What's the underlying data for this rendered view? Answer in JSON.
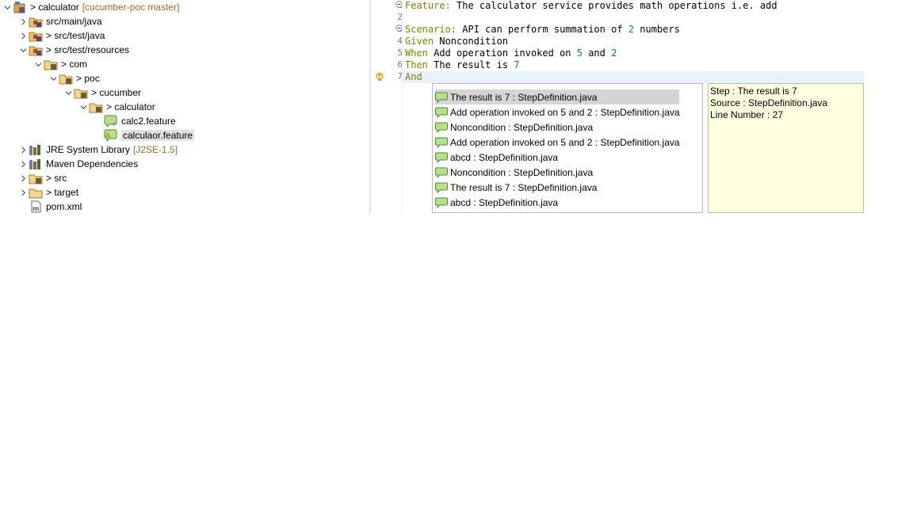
{
  "explorer": {
    "items": [
      {
        "label": "> calculator",
        "suffix": "[cucumber-poc master]",
        "icon": "project-icon"
      },
      {
        "label": "src/main/java",
        "icon": "source-folder-icon"
      },
      {
        "label": "> src/test/java",
        "icon": "source-folder-icon"
      },
      {
        "label": "> src/test/resources",
        "icon": "source-folder-icon"
      },
      {
        "label": "> com",
        "icon": "package-folder-icon"
      },
      {
        "label": "> poc",
        "icon": "package-folder-icon"
      },
      {
        "label": "> cucumber",
        "icon": "package-folder-icon"
      },
      {
        "label": "> calculator",
        "icon": "package-folder-icon"
      },
      {
        "label": "calc2.feature",
        "icon": "feature-file-icon"
      },
      {
        "label": "calculaor.feature",
        "icon": "feature-file-icon"
      },
      {
        "label": "JRE System Library",
        "suffix": "[J2SE-1.5]",
        "icon": "library-icon"
      },
      {
        "label": "Maven Dependencies",
        "icon": "library-icon"
      },
      {
        "label": "> src",
        "icon": "folder-icon"
      },
      {
        "label": "> target",
        "icon": "folder-icon"
      },
      {
        "label": "pom.xml",
        "icon": "xml-file-icon"
      }
    ]
  },
  "editor": {
    "line_numbers": [
      "1",
      "2",
      "3",
      "4",
      "5",
      "6",
      "7"
    ],
    "lines": [
      {
        "kw": "Feature:",
        "rest": " The calculator service provides math operations i.e. add"
      },
      {
        "kw": "",
        "rest": ""
      },
      {
        "kw": "Scenario:",
        "rest": " API can perform summation of ",
        "num": "2",
        "tail": " numbers"
      },
      {
        "kw": "Given",
        "rest": " Noncondition"
      },
      {
        "kw": "When",
        "rest": " Add operation invoked on ",
        "num": "5",
        "mid": " and ",
        "num2": "2"
      },
      {
        "kw": "Then",
        "rest": " The result is ",
        "num": "7"
      },
      {
        "kw": "And",
        "rest": ""
      }
    ]
  },
  "assist": {
    "proposals": [
      "The result is 7 : StepDefinition.java",
      "Add operation invoked on 5 and 2 : StepDefinition.java",
      "Noncondition : StepDefinition.java",
      "Add operation invoked on 5 and 2 : StepDefinition.java",
      "abcd : StepDefinition.java",
      "Noncondition : StepDefinition.java",
      "The result is 7 : StepDefinition.java",
      "abcd : StepDefinition.java"
    ],
    "selected_index": 0
  },
  "info": {
    "step": "Step : The result is 7",
    "source": "Source : StepDefinition.java",
    "line_number": "Line Number : 27"
  },
  "colors": {
    "keyword": "#7f7f00",
    "number": "#098658",
    "current_line": "#e8f2fe",
    "info_background": "#ffffe1"
  }
}
